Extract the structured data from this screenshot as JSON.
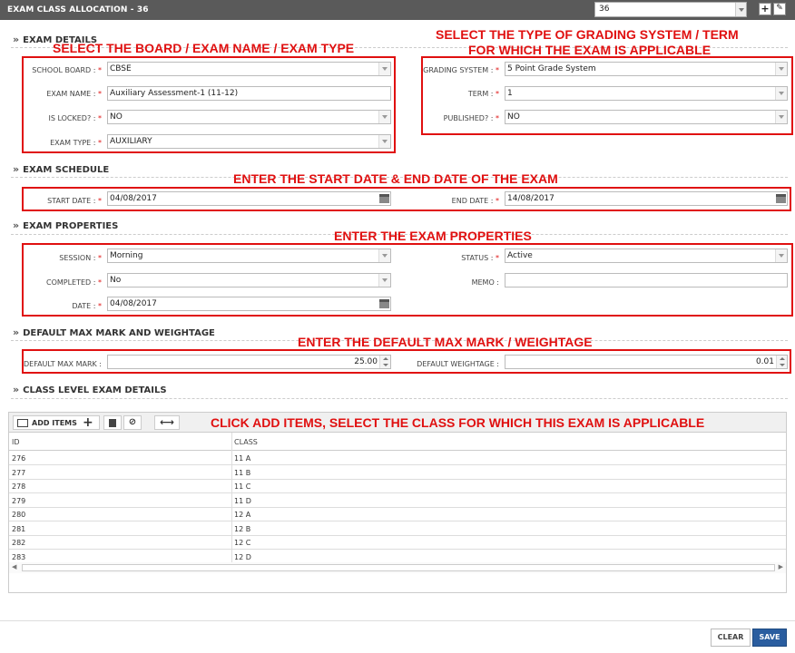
{
  "window": {
    "title": "EXAM CLASS ALLOCATION - 36",
    "record_selector_value": "36",
    "add_icon": "plus-icon",
    "edit_icon": "edit-icon"
  },
  "sections": {
    "exam_details": "EXAM DETAILS",
    "exam_schedule": "EXAM SCHEDULE",
    "exam_properties": "EXAM PROPERTIES",
    "default_max_mark": "DEFAULT MAX MARK AND WEIGHTAGE",
    "class_level": "CLASS LEVEL EXAM DETAILS"
  },
  "annotations": {
    "board": "SELECT THE BOARD / EXAM NAME / EXAM TYPE",
    "grading_line1": "SELECT THE TYPE OF GRADING SYSTEM / TERM",
    "grading_line2": "FOR WHICH THE EXAM IS APPLICABLE",
    "dates": "ENTER THE START DATE & END DATE OF THE EXAM",
    "properties": "ENTER THE EXAM PROPERTIES",
    "max_mark": "ENTER THE DEFAULT MAX MARK / WEIGHTAGE",
    "add_items": "CLICK ADD ITEMS, SELECT THE CLASS FOR WHICH THIS EXAM IS APPLICABLE"
  },
  "exam_details": {
    "school_board_label": "SCHOOL BOARD :",
    "school_board_value": "CBSE",
    "exam_name_label": "EXAM NAME :",
    "exam_name_value": "Auxiliary Assessment-1 (11-12)",
    "is_locked_label": "IS LOCKED? :",
    "is_locked_value": "NO",
    "exam_type_label": "EXAM TYPE :",
    "exam_type_value": "AUXILIARY",
    "grading_system_label": "GRADING SYSTEM :",
    "grading_system_value": "5 Point Grade System",
    "term_label": "TERM :",
    "term_value": "1",
    "published_label": "PUBLISHED? :",
    "published_value": "NO"
  },
  "exam_schedule": {
    "start_date_label": "START DATE :",
    "start_date_value": "04/08/2017",
    "end_date_label": "END DATE :",
    "end_date_value": "14/08/2017"
  },
  "exam_properties": {
    "session_label": "SESSION :",
    "session_value": "Morning",
    "completed_label": "COMPLETED :",
    "completed_value": "No",
    "date_label": "DATE :",
    "date_value": "04/08/2017",
    "status_label": "STATUS :",
    "status_value": "Active",
    "memo_label": "MEMO :",
    "memo_value": ""
  },
  "max_mark": {
    "default_max_mark_label": "DEFAULT MAX MARK :",
    "default_max_mark_value": "25.00",
    "default_weightage_label": "DEFAULT WEIGHTAGE :",
    "default_weightage_value": "0.01"
  },
  "grid": {
    "add_items_label": "ADD ITEMS",
    "columns": [
      "ID",
      "CLASS"
    ],
    "rows": [
      [
        "276",
        "11 A"
      ],
      [
        "277",
        "11 B"
      ],
      [
        "278",
        "11 C"
      ],
      [
        "279",
        "11 D"
      ],
      [
        "280",
        "12 A"
      ],
      [
        "281",
        "12 B"
      ],
      [
        "282",
        "12 C"
      ],
      [
        "283",
        "12 D"
      ]
    ]
  },
  "footer": {
    "clear_label": "CLEAR",
    "save_label": "SAVE"
  },
  "colors": {
    "title_bar": "#5a5a5a",
    "annotation_red": "#e01010",
    "save_button": "#2a5d9f"
  },
  "required_marker": "*"
}
